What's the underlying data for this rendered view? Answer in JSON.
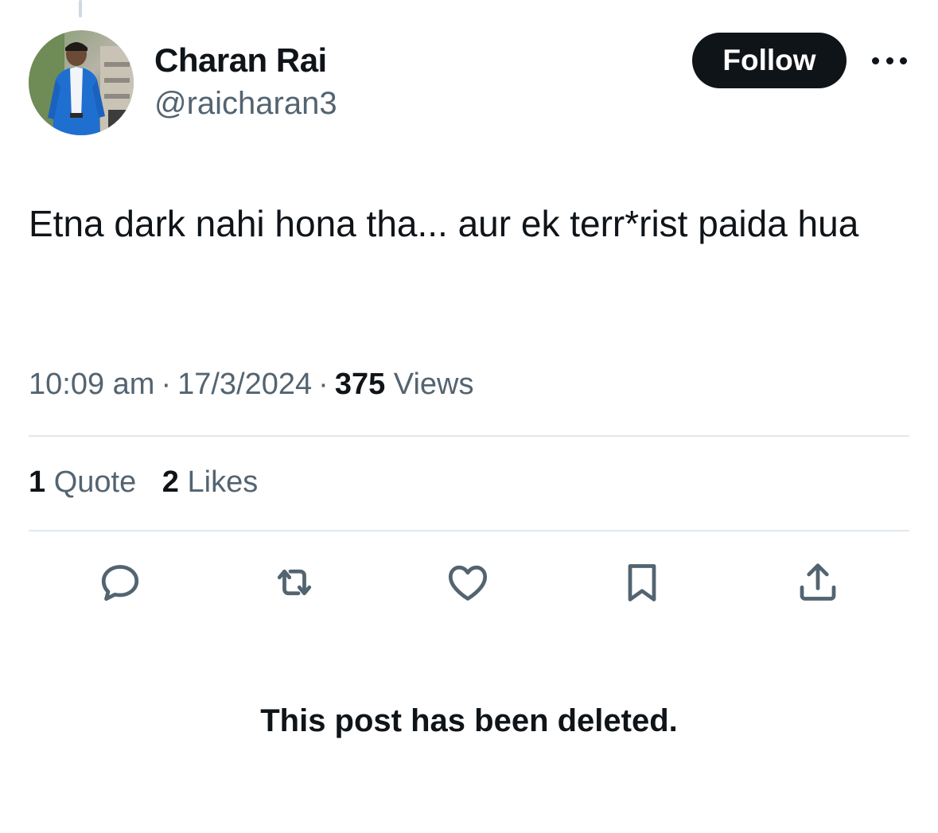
{
  "post": {
    "author": {
      "name": "Charan Rai",
      "handle": "@raicharan3"
    },
    "follow_label": "Follow",
    "text": "Etna dark nahi hona tha... aur ek terr*rist paida hua",
    "time": "10:09 am",
    "date": "17/3/2024",
    "separator": "·",
    "views_count": "375",
    "views_label": "Views",
    "stats": {
      "quote_count": "1",
      "quote_label": "Quote",
      "likes_count": "2",
      "likes_label": "Likes"
    },
    "actions": [
      {
        "icon": "reply-icon"
      },
      {
        "icon": "repost-icon"
      },
      {
        "icon": "like-icon"
      },
      {
        "icon": "bookmark-icon"
      },
      {
        "icon": "share-icon"
      }
    ]
  },
  "deleted_notice": "This post has been deleted.",
  "colors": {
    "text_primary": "#0f1419",
    "text_secondary": "#536471",
    "divider": "#e1e8ed",
    "follow_bg": "#0f1419"
  }
}
